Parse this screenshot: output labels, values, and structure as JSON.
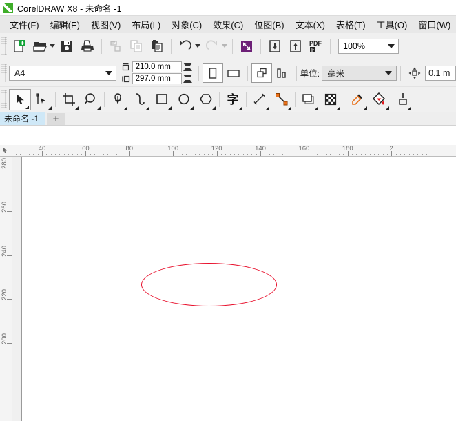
{
  "titlebar": {
    "icon": "coreldraw-logo-icon",
    "title": "CorelDRAW X8 - 未命名 -1"
  },
  "menubar": {
    "items": [
      {
        "name": "file",
        "label": "文件(F)"
      },
      {
        "name": "edit",
        "label": "编辑(E)"
      },
      {
        "name": "view",
        "label": "视图(V)"
      },
      {
        "name": "layout",
        "label": "布局(L)"
      },
      {
        "name": "object",
        "label": "对象(C)"
      },
      {
        "name": "effects",
        "label": "效果(C)"
      },
      {
        "name": "bitmap",
        "label": "位图(B)"
      },
      {
        "name": "text",
        "label": "文本(X)"
      },
      {
        "name": "table",
        "label": "表格(T)"
      },
      {
        "name": "tools",
        "label": "工具(O)"
      },
      {
        "name": "window",
        "label": "窗口(W)"
      }
    ]
  },
  "toolbar": {
    "buttons": [
      {
        "name": "new-document-button",
        "icon": "new-document-icon"
      },
      {
        "name": "open-document-button",
        "icon": "open-folder-icon"
      },
      {
        "name": "save-document-button",
        "icon": "floppy-save-icon"
      },
      {
        "name": "print-button",
        "icon": "printer-icon"
      },
      {
        "name": "cut-button",
        "icon": "scissors-cut-icon"
      },
      {
        "name": "copy-button",
        "icon": "copy-icon"
      },
      {
        "name": "paste-button",
        "icon": "paste-icon"
      },
      {
        "name": "undo-button",
        "icon": "undo-arrow-icon"
      },
      {
        "name": "redo-button",
        "icon": "redo-arrow-icon"
      },
      {
        "name": "import-export-button",
        "icon": "purple-arrows-icon"
      },
      {
        "name": "import-button",
        "icon": "import-down-arrow-icon"
      },
      {
        "name": "export-button",
        "icon": "export-up-arrow-icon"
      },
      {
        "name": "publish-pdf-button",
        "icon": "pdf-icon"
      }
    ],
    "zoom_level": "100%"
  },
  "propertybar": {
    "page_size": "A4",
    "page_width": "210.0 mm",
    "page_height": "297.0 mm",
    "orientation_portrait": "portrait-icon",
    "orientation_landscape": "landscape-icon",
    "all_pages_icon": "all-pages-icon",
    "current_page_icon": "current-page-icon",
    "unit_label": "单位:",
    "unit_value": "毫米",
    "nudge_icon": "nudge-arrows-icon",
    "nudge_value": "0.1 m"
  },
  "toolbox": {
    "tools": [
      {
        "name": "pick-tool",
        "icon": "arrow-cursor-icon",
        "active": true
      },
      {
        "name": "shape-tool",
        "icon": "node-edit-icon",
        "active": false
      },
      {
        "name": "crop-tool",
        "icon": "crop-icon",
        "active": false
      },
      {
        "name": "zoom-tool",
        "icon": "magnifier-icon",
        "active": false
      },
      {
        "name": "freehand-tool",
        "icon": "pen-nib-icon",
        "active": false
      },
      {
        "name": "artistic-media-tool",
        "icon": "brush-stroke-icon",
        "active": false
      },
      {
        "name": "rectangle-tool",
        "icon": "square-icon",
        "active": false
      },
      {
        "name": "ellipse-tool",
        "icon": "circle-icon",
        "active": false
      },
      {
        "name": "polygon-tool",
        "icon": "hexagon-icon",
        "active": false
      },
      {
        "name": "text-tool",
        "icon": "text-character-icon",
        "active": false
      },
      {
        "name": "parallel-dimension-tool",
        "icon": "dimension-line-icon",
        "active": false
      },
      {
        "name": "straight-line-connector-tool",
        "icon": "connector-line-icon",
        "active": false
      },
      {
        "name": "drop-shadow-tool",
        "icon": "drop-shadow-icon",
        "active": false
      },
      {
        "name": "transparency-tool",
        "icon": "checkerboard-icon",
        "active": false
      },
      {
        "name": "color-eyedropper-tool",
        "icon": "eyedropper-icon",
        "active": false
      },
      {
        "name": "interactive-fill-tool",
        "icon": "fill-bucket-icon",
        "active": false
      },
      {
        "name": "outline-tool",
        "icon": "outline-pen-icon",
        "active": false
      }
    ]
  },
  "tabstrip": {
    "document_tab": "未命名 -1",
    "add_tab": "+"
  },
  "rulers": {
    "horizontal_labels": [
      "40",
      "60",
      "80",
      "100",
      "120",
      "140",
      "160",
      "180",
      "2"
    ],
    "vertical_labels": [
      "280",
      "260",
      "240",
      "220",
      "200"
    ],
    "origin_icon": "ruler-origin-icon"
  },
  "canvas": {
    "shape": "ellipse",
    "outline_color": "#e8112d",
    "fill": "none"
  }
}
